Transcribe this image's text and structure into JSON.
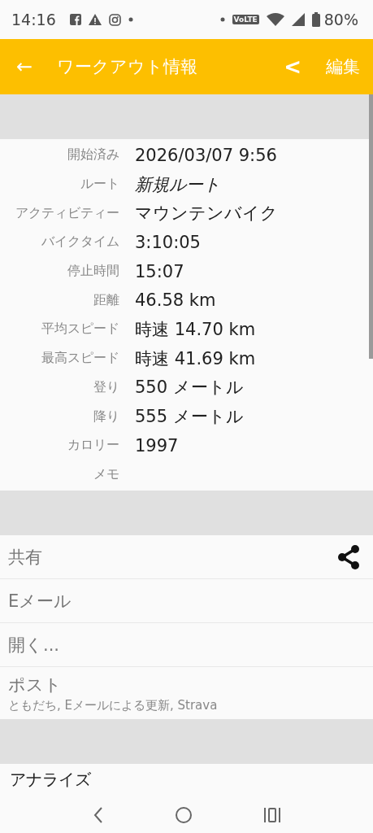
{
  "status_bar": {
    "time": "14:16",
    "network": "VoLTE",
    "battery": "80%"
  },
  "app_bar": {
    "back": "←",
    "title": "ワークアウト情報",
    "prev": "<",
    "edit": "編集"
  },
  "details": [
    {
      "label": "開始済み",
      "value": "2026/03/07 9:56",
      "italic": false
    },
    {
      "label": "ルート",
      "value": "新規ルート",
      "italic": true
    },
    {
      "label": "アクティビティー",
      "value": "マウンテンバイク",
      "italic": false
    },
    {
      "label": "バイクタイム",
      "value": "3:10:05",
      "italic": false
    },
    {
      "label": "停止時間",
      "value": "15:07",
      "italic": false
    },
    {
      "label": "距離",
      "value": "46.58 km",
      "italic": false
    },
    {
      "label": "平均スピード",
      "value": "時速 14.70 km",
      "italic": false
    },
    {
      "label": "最高スピード",
      "value": "時速 41.69 km",
      "italic": false
    },
    {
      "label": "登り",
      "value": "550 メートル",
      "italic": false
    },
    {
      "label": "降り",
      "value": "555 メートル",
      "italic": false
    },
    {
      "label": "カロリー",
      "value": "1997",
      "italic": false
    },
    {
      "label": "メモ"
    }
  ],
  "actions": [
    {
      "kind": "share",
      "label": "共有"
    },
    {
      "kind": "plain",
      "label": "Eメール"
    },
    {
      "kind": "plain",
      "label": "開く..."
    },
    {
      "kind": "sub",
      "label": "ポスト",
      "subtitle": "ともだち, Eメールによる更新, Strava"
    }
  ],
  "analysis": {
    "title": "アナライズ"
  }
}
